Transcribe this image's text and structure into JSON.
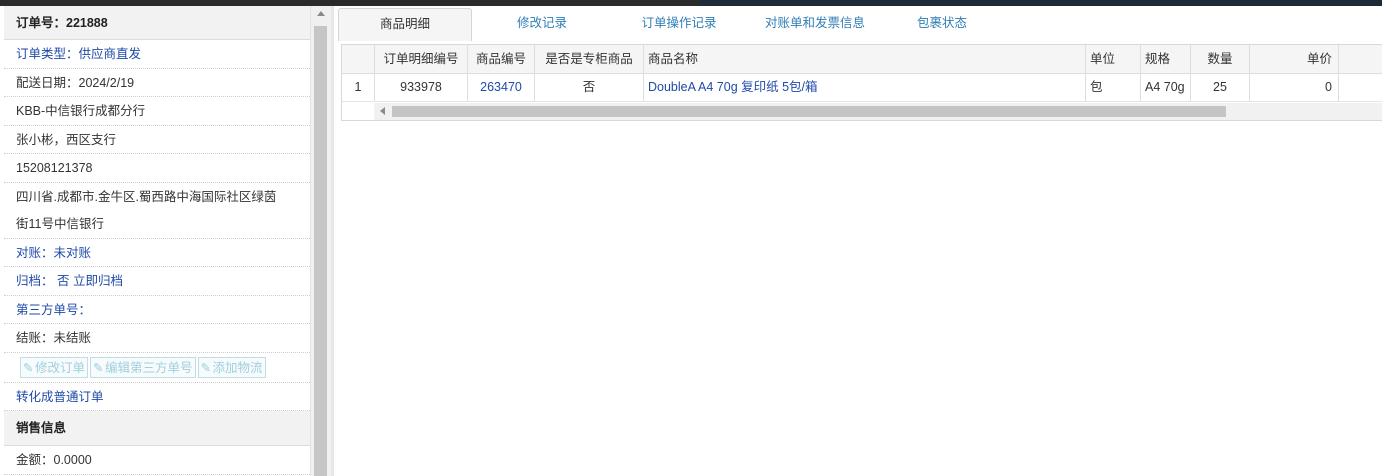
{
  "order": {
    "number_label": "订单号：221888",
    "type": "订单类型：供应商直发",
    "delivery_date": "配送日期：2024/2/19",
    "branch": "KBB-中信银行成都分行",
    "contact": "张小彬，西区支行",
    "phone": "15208121378",
    "address_line1": "四川省.成都市.金牛区.蜀西路中海国际社区绿茵",
    "address_line2": "街11号中信银行",
    "reconcile": "对账：未对账",
    "archive": "归档：  否 立即归档",
    "third_party": "第三方单号：",
    "settlement": "结账：未结账",
    "buttons": {
      "edit_order": "修改订单",
      "edit_third_party": "编辑第三方单号",
      "add_logistics": "添加物流"
    },
    "convert": "转化成普通订单"
  },
  "sales": {
    "header": "销售信息",
    "amount": "金额：0.0000"
  },
  "tabs": [
    {
      "label": "商品明细",
      "active": true
    },
    {
      "label": "修改记录",
      "active": false
    },
    {
      "label": "订单操作记录",
      "active": false
    },
    {
      "label": "对账单和发票信息",
      "active": false
    },
    {
      "label": "包裹状态",
      "active": false
    }
  ],
  "grid": {
    "columns": [
      "",
      "订单明细编号",
      "商品编号",
      "是否是专柜商品",
      "商品名称",
      "单位",
      "规格",
      "数量",
      "单价"
    ],
    "rows": [
      [
        "1",
        "933978",
        "263470",
        "否",
        "DoubleA A4 70g 复印纸 5包/箱",
        "包",
        "A4 70g",
        "25",
        "0"
      ]
    ]
  },
  "icons": {
    "edit": "edit-icon",
    "scroll_up": "scroll-up-arrow-icon",
    "scroll_left": "scroll-left-arrow-icon"
  }
}
